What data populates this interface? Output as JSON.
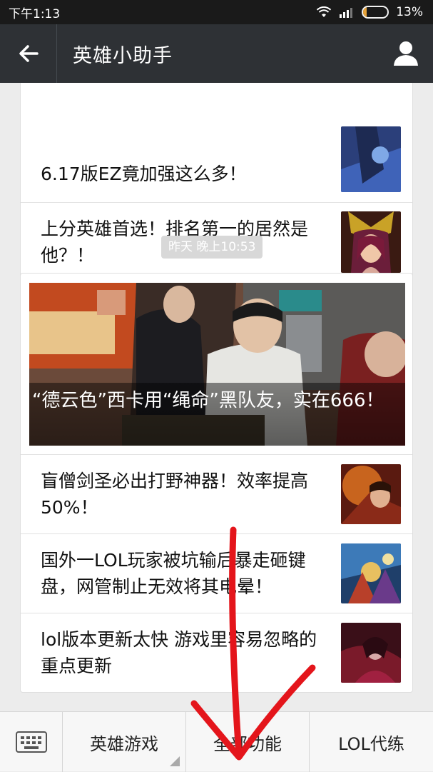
{
  "status_bar": {
    "time": "下午1:13",
    "battery": "13%",
    "battery_level": 0.13
  },
  "header": {
    "title": "英雄小助手"
  },
  "feed": {
    "top_card": {
      "partial_title": "6.17版EZ竟加强这么多！",
      "items": [
        {
          "title": "上分英雄首选！排名第一的居然是他？！"
        }
      ]
    },
    "timestamp": "昨天 晚上10:53",
    "main_card": {
      "headline": "“德云色”西卡用“绳命”黑队友，实在666！",
      "items": [
        {
          "title": "盲僧剑圣必出打野神器！效率提高50%！"
        },
        {
          "title": "国外一LOL玩家被坑输后暴走砸键盘，网管制止无效将其电晕！"
        },
        {
          "title": "lol版本更新太快 游戏里容易忽略的重点更新"
        }
      ]
    }
  },
  "bottom_menu": {
    "items": [
      {
        "label": "英雄游戏"
      },
      {
        "label": "全部功能"
      },
      {
        "label": "LOL代练"
      }
    ]
  },
  "colors": {
    "nav_bg": "#2e3135",
    "status_bg": "#1a1a1a",
    "annotation_arrow": "#e4151b"
  }
}
